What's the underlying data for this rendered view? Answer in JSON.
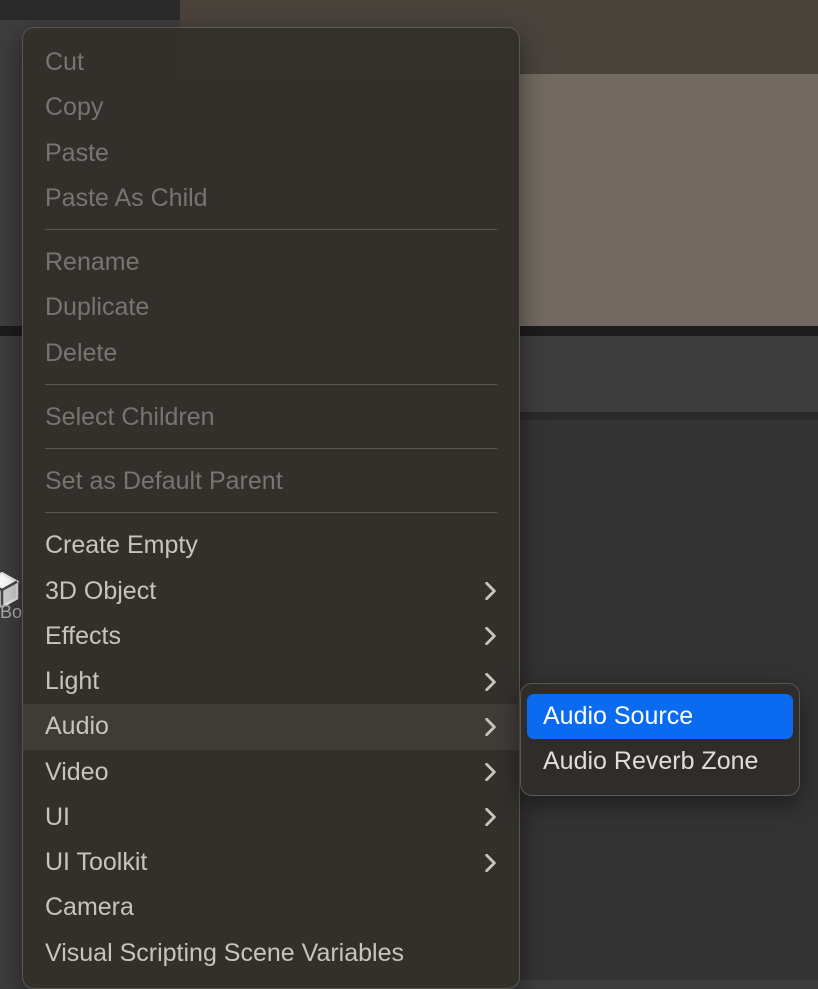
{
  "contextMenu": {
    "groups": [
      [
        {
          "label": "Cut",
          "disabled": true,
          "hasSubmenu": false
        },
        {
          "label": "Copy",
          "disabled": true,
          "hasSubmenu": false
        },
        {
          "label": "Paste",
          "disabled": true,
          "hasSubmenu": false
        },
        {
          "label": "Paste As Child",
          "disabled": true,
          "hasSubmenu": false
        }
      ],
      [
        {
          "label": "Rename",
          "disabled": true,
          "hasSubmenu": false
        },
        {
          "label": "Duplicate",
          "disabled": true,
          "hasSubmenu": false
        },
        {
          "label": "Delete",
          "disabled": true,
          "hasSubmenu": false
        }
      ],
      [
        {
          "label": "Select Children",
          "disabled": true,
          "hasSubmenu": false
        }
      ],
      [
        {
          "label": "Set as Default Parent",
          "disabled": true,
          "hasSubmenu": false
        }
      ],
      [
        {
          "label": "Create Empty",
          "disabled": false,
          "hasSubmenu": false
        },
        {
          "label": "3D Object",
          "disabled": false,
          "hasSubmenu": true
        },
        {
          "label": "Effects",
          "disabled": false,
          "hasSubmenu": true
        },
        {
          "label": "Light",
          "disabled": false,
          "hasSubmenu": true
        },
        {
          "label": "Audio",
          "disabled": false,
          "hasSubmenu": true,
          "hovered": true
        },
        {
          "label": "Video",
          "disabled": false,
          "hasSubmenu": true
        },
        {
          "label": "UI",
          "disabled": false,
          "hasSubmenu": true
        },
        {
          "label": "UI Toolkit",
          "disabled": false,
          "hasSubmenu": true
        },
        {
          "label": "Camera",
          "disabled": false,
          "hasSubmenu": false
        },
        {
          "label": "Visual Scripting Scene Variables",
          "disabled": false,
          "hasSubmenu": false
        }
      ]
    ]
  },
  "submenu": {
    "items": [
      {
        "label": "Audio Source",
        "selected": true
      },
      {
        "label": "Audio Reverb Zone",
        "selected": false
      }
    ]
  },
  "backgroundLabel": "Bo"
}
